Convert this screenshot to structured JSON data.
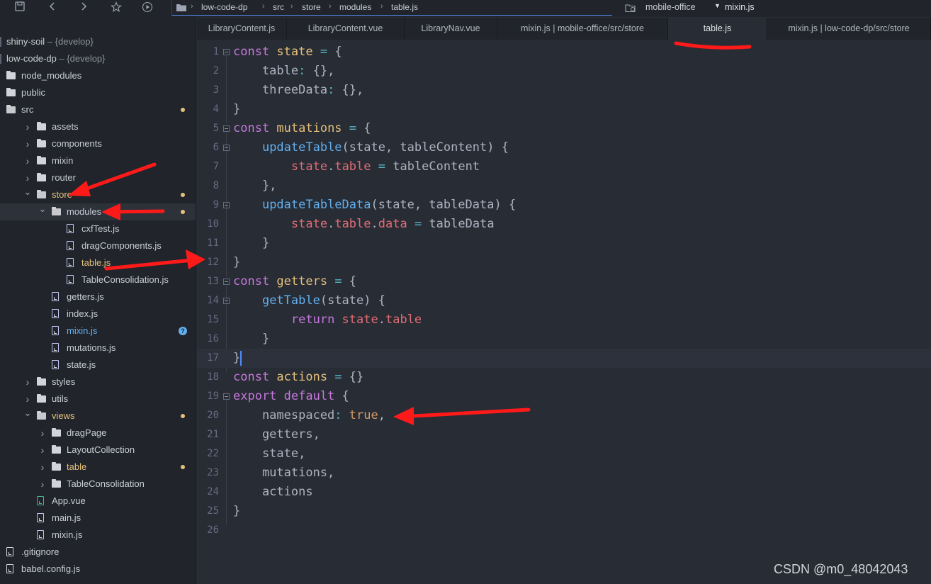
{
  "toolbar": {
    "icons": [
      "save-icon",
      "back-icon",
      "forward-icon",
      "bookmark-star-icon",
      "run-icon"
    ]
  },
  "breadcrumb": [
    "low-code-dp",
    "src",
    "store",
    "modules",
    "table.js"
  ],
  "project_switcher": {
    "project": "mobile-office",
    "file": "mixin.js"
  },
  "tabs": [
    {
      "label": "LibraryContent.js",
      "active": false
    },
    {
      "label": "LibraryContent.vue",
      "active": false
    },
    {
      "label": "LibraryNav.vue",
      "active": false
    },
    {
      "label": "mixin.js | mobile-office/src/store",
      "active": false
    },
    {
      "label": "table.js",
      "active": true
    },
    {
      "label": "mixin.js | low-code-dp/src/store",
      "active": false
    }
  ],
  "sidebar": {
    "items": [
      {
        "label": "shiny-soil",
        "branch": " – {develop}",
        "kind": "root",
        "depth": 0
      },
      {
        "label": "low-code-dp",
        "branch": " – {develop}",
        "kind": "root",
        "depth": 0
      },
      {
        "label": "node_modules",
        "kind": "folder",
        "depth": 0
      },
      {
        "label": "public",
        "kind": "folder",
        "depth": 0
      },
      {
        "label": "src",
        "kind": "folder-open",
        "depth": 0,
        "dot": true
      },
      {
        "label": "assets",
        "kind": "folder",
        "depth": 1,
        "arrow": "›"
      },
      {
        "label": "components",
        "kind": "folder",
        "depth": 1,
        "arrow": "›"
      },
      {
        "label": "mixin",
        "kind": "folder",
        "depth": 1,
        "arrow": "›"
      },
      {
        "label": "router",
        "kind": "folder",
        "depth": 1,
        "arrow": "›"
      },
      {
        "label": "store",
        "kind": "folder-open",
        "depth": 1,
        "arrow": "⌄",
        "dot": true,
        "color": "yellow"
      },
      {
        "label": "modules",
        "kind": "folder-open",
        "depth": 2,
        "arrow": "⌄",
        "dot": true,
        "selected": true
      },
      {
        "label": "cxfTest.js",
        "kind": "file-js",
        "depth": 3
      },
      {
        "label": "dragComponents.js",
        "kind": "file-js",
        "depth": 3
      },
      {
        "label": "table.js",
        "kind": "file-js",
        "depth": 3,
        "color": "yellow"
      },
      {
        "label": "TableConsolidation.js",
        "kind": "file-js",
        "depth": 3
      },
      {
        "label": "getters.js",
        "kind": "file-js",
        "depth": 2
      },
      {
        "label": "index.js",
        "kind": "file-js",
        "depth": 2
      },
      {
        "label": "mixin.js",
        "kind": "file-js",
        "depth": 2,
        "color": "blue",
        "badge": "?"
      },
      {
        "label": "mutations.js",
        "kind": "file-js",
        "depth": 2
      },
      {
        "label": "state.js",
        "kind": "file-js",
        "depth": 2
      },
      {
        "label": "styles",
        "kind": "folder",
        "depth": 1,
        "arrow": "›"
      },
      {
        "label": "utils",
        "kind": "folder",
        "depth": 1,
        "arrow": "›"
      },
      {
        "label": "views",
        "kind": "folder-open",
        "depth": 1,
        "arrow": "⌄",
        "dot": true,
        "color": "yellow"
      },
      {
        "label": "dragPage",
        "kind": "folder",
        "depth": 2,
        "arrow": "›"
      },
      {
        "label": "LayoutCollection",
        "kind": "folder",
        "depth": 2,
        "arrow": "›"
      },
      {
        "label": "table",
        "kind": "folder",
        "depth": 2,
        "arrow": "›",
        "dot": true,
        "color": "yellow"
      },
      {
        "label": "TableConsolidation",
        "kind": "folder",
        "depth": 2,
        "arrow": "›"
      },
      {
        "label": "App.vue",
        "kind": "file-vue",
        "depth": 1
      },
      {
        "label": "main.js",
        "kind": "file-js",
        "depth": 1
      },
      {
        "label": "mixin.js",
        "kind": "file-js",
        "depth": 1
      },
      {
        "label": ".gitignore",
        "kind": "file",
        "depth": 0
      },
      {
        "label": "babel.config.js",
        "kind": "file",
        "depth": 0
      }
    ]
  },
  "editor": {
    "lines": [
      {
        "n": "1",
        "fold": true,
        "tokens": [
          [
            "const ",
            "#c678dd"
          ],
          [
            "state",
            "#e5c07b"
          ],
          [
            " = ",
            "#56b6c2"
          ],
          [
            "{",
            "#abb2bf"
          ]
        ]
      },
      {
        "n": "2",
        "tokens": [
          [
            "    table",
            "#abb2bf"
          ],
          [
            ": ",
            "#56b6c2"
          ],
          [
            "{},",
            "#abb2bf"
          ]
        ]
      },
      {
        "n": "3",
        "tokens": [
          [
            "    threeData",
            "#abb2bf"
          ],
          [
            ": ",
            "#56b6c2"
          ],
          [
            "{},",
            "#abb2bf"
          ]
        ]
      },
      {
        "n": "4",
        "tokens": [
          [
            "}",
            "#abb2bf"
          ]
        ]
      },
      {
        "n": "5",
        "fold": true,
        "tokens": [
          [
            "const ",
            "#c678dd"
          ],
          [
            "mutations",
            "#e5c07b"
          ],
          [
            " = ",
            "#56b6c2"
          ],
          [
            "{",
            "#abb2bf"
          ]
        ]
      },
      {
        "n": "6",
        "fold": true,
        "tokens": [
          [
            "    ",
            "#abb2bf"
          ],
          [
            "updateTable",
            "#61afef"
          ],
          [
            "(state, tableContent) {",
            "#abb2bf"
          ]
        ]
      },
      {
        "n": "7",
        "tokens": [
          [
            "        ",
            "#abb2bf"
          ],
          [
            "state",
            "#e06c75"
          ],
          [
            ".",
            "#abb2bf"
          ],
          [
            "table",
            "#e06c75"
          ],
          [
            " = ",
            "#56b6c2"
          ],
          [
            "tableContent",
            "#abb2bf"
          ]
        ]
      },
      {
        "n": "8",
        "tokens": [
          [
            "    },",
            "#abb2bf"
          ]
        ]
      },
      {
        "n": "9",
        "fold": true,
        "tokens": [
          [
            "    ",
            "#abb2bf"
          ],
          [
            "updateTableData",
            "#61afef"
          ],
          [
            "(state, tableData) {",
            "#abb2bf"
          ]
        ]
      },
      {
        "n": "10",
        "tokens": [
          [
            "        ",
            "#abb2bf"
          ],
          [
            "state",
            "#e06c75"
          ],
          [
            ".",
            "#abb2bf"
          ],
          [
            "table",
            "#e06c75"
          ],
          [
            ".",
            "#abb2bf"
          ],
          [
            "data",
            "#e06c75"
          ],
          [
            " = ",
            "#56b6c2"
          ],
          [
            "tableData",
            "#abb2bf"
          ]
        ]
      },
      {
        "n": "11",
        "tokens": [
          [
            "    }",
            "#abb2bf"
          ]
        ]
      },
      {
        "n": "12",
        "tokens": [
          [
            "}",
            "#abb2bf"
          ]
        ]
      },
      {
        "n": "13",
        "fold": true,
        "tokens": [
          [
            "const ",
            "#c678dd"
          ],
          [
            "getters",
            "#e5c07b"
          ],
          [
            " = ",
            "#56b6c2"
          ],
          [
            "{",
            "#abb2bf"
          ]
        ]
      },
      {
        "n": "14",
        "fold": true,
        "tokens": [
          [
            "    ",
            "#abb2bf"
          ],
          [
            "getTable",
            "#61afef"
          ],
          [
            "(state) {",
            "#abb2bf"
          ]
        ]
      },
      {
        "n": "15",
        "tokens": [
          [
            "        ",
            "#abb2bf"
          ],
          [
            "return ",
            "#c678dd"
          ],
          [
            "state",
            "#e06c75"
          ],
          [
            ".",
            "#abb2bf"
          ],
          [
            "table",
            "#e06c75"
          ]
        ]
      },
      {
        "n": "16",
        "tokens": [
          [
            "    }",
            "#abb2bf"
          ]
        ]
      },
      {
        "n": "17",
        "current": true,
        "tokens": [
          [
            "}",
            "#abb2bf"
          ]
        ]
      },
      {
        "n": "18",
        "tokens": [
          [
            "const ",
            "#c678dd"
          ],
          [
            "actions",
            "#e5c07b"
          ],
          [
            " = ",
            "#56b6c2"
          ],
          [
            "{}",
            "#abb2bf"
          ]
        ]
      },
      {
        "n": "19",
        "fold": true,
        "tokens": [
          [
            "export ",
            "#c678dd"
          ],
          [
            "default ",
            "#c678dd"
          ],
          [
            "{",
            "#abb2bf"
          ]
        ]
      },
      {
        "n": "20",
        "tokens": [
          [
            "    namespaced",
            "#abb2bf"
          ],
          [
            ": ",
            "#56b6c2"
          ],
          [
            "true",
            "#d19a66"
          ],
          [
            ",",
            "#abb2bf"
          ]
        ]
      },
      {
        "n": "21",
        "tokens": [
          [
            "    getters,",
            "#abb2bf"
          ]
        ]
      },
      {
        "n": "22",
        "tokens": [
          [
            "    state,",
            "#abb2bf"
          ]
        ]
      },
      {
        "n": "23",
        "tokens": [
          [
            "    mutations,",
            "#abb2bf"
          ]
        ]
      },
      {
        "n": "24",
        "tokens": [
          [
            "    actions",
            "#abb2bf"
          ]
        ]
      },
      {
        "n": "25",
        "tokens": [
          [
            "}",
            "#abb2bf"
          ]
        ]
      },
      {
        "n": "26",
        "tokens": []
      }
    ]
  },
  "watermark": "CSDN @m0_48042043",
  "colors": {
    "annotation": "#ff1a1a",
    "accent": "#568af2"
  }
}
